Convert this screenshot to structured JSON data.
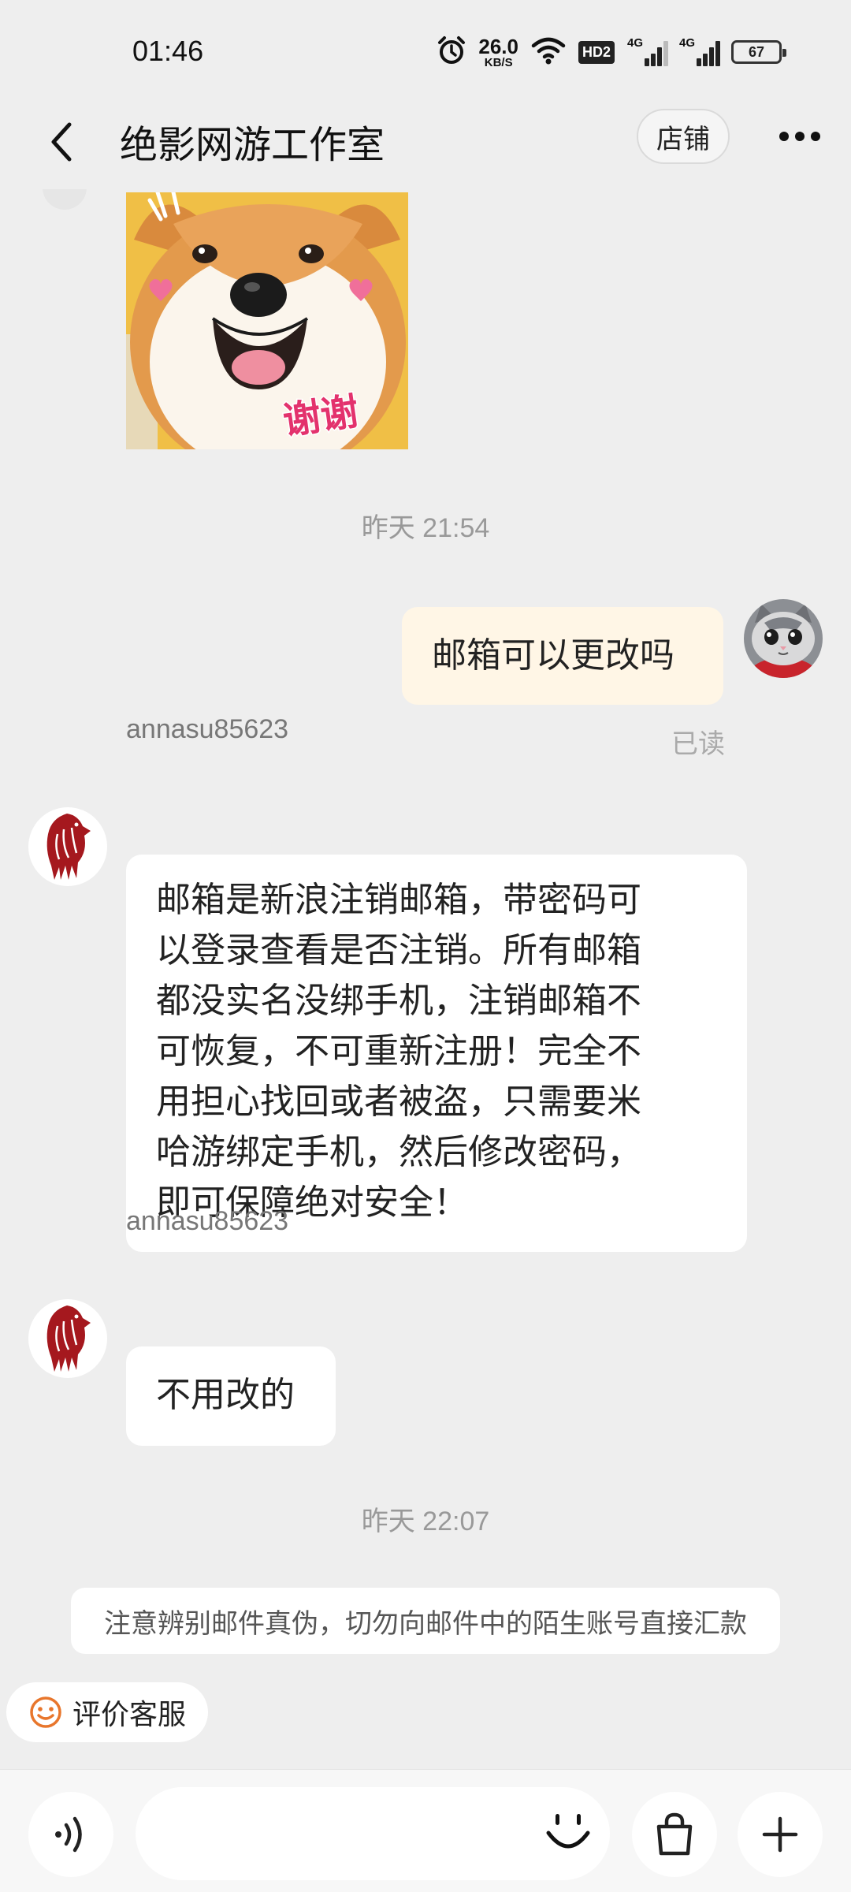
{
  "status_bar": {
    "time": "01:46",
    "net_speed_value": "26.0",
    "net_speed_unit": "KB/S",
    "hd_badge": "HD2",
    "signal_1_label": "4G",
    "signal_2_label": "4G",
    "battery_level": "67",
    "icons": [
      "alarm-icon",
      "wifi-icon",
      "signal-icon",
      "signal-icon",
      "battery-icon"
    ]
  },
  "header": {
    "title": "绝影网游工作室",
    "shop_label": "店铺",
    "back_icon": "chevron-left-icon",
    "more_icon": "more-dots-icon"
  },
  "messages": {
    "sticker_text": "谢谢",
    "time_1": "昨天  21:54",
    "outgoing_1": "邮箱可以更改吗",
    "read_status": "已读",
    "sender_1": "annasu85623",
    "incoming_1_lines": [
      "邮箱是新浪注销邮箱，带密码可",
      "以登录查看是否注销。所有邮箱",
      "都没实名没绑手机，注销邮箱不",
      "可恢复，不可重新注册！完全不",
      "用担心找回或者被盗，只需要米",
      "哈游绑定手机，然后修改密码，",
      "即可保障绝对安全！"
    ],
    "sender_2": "annasu85623",
    "incoming_2": "不用改的",
    "time_2": "昨天  22:07"
  },
  "notice": {
    "text": "注意辨别邮件真伪，切勿向邮件中的陌生账号直接汇款"
  },
  "rate_service": {
    "label": "评价客服",
    "icon": "smile-icon",
    "icon_color": "#e8762c"
  },
  "input_bar": {
    "text_value": "",
    "voice_icon": "voice-icon",
    "emoji_icon": "emoji-icon",
    "goods_icon": "shopping-bag-icon",
    "plus_icon": "plus-icon"
  },
  "colors": {
    "background": "#eeeeee",
    "outgoing_bubble": "#fff6e6",
    "incoming_bubble": "#ffffff",
    "logo_red": "#a5181e"
  }
}
